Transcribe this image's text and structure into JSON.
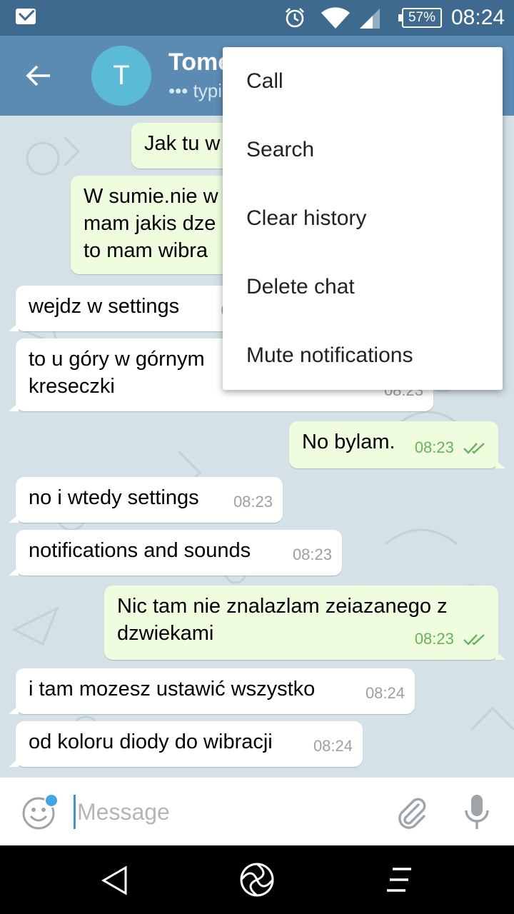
{
  "status_bar": {
    "battery": "57%",
    "time": "08:24"
  },
  "header": {
    "avatar_letter": "T",
    "contact_name": "Tomek",
    "status": "••• typing"
  },
  "menu": {
    "items": [
      {
        "label": "Call"
      },
      {
        "label": "Search"
      },
      {
        "label": "Clear history"
      },
      {
        "label": "Delete chat"
      },
      {
        "label": "Mute notifications"
      }
    ]
  },
  "messages": [
    {
      "dir": "out",
      "lines": [
        "Jak tu w"
      ],
      "time": ""
    },
    {
      "dir": "out",
      "lines": [
        "W sumie.nie w",
        "mam jakis dze",
        "to mam wibra"
      ],
      "time": ""
    },
    {
      "dir": "in",
      "lines": [
        "wejdz w settings"
      ],
      "time": "08"
    },
    {
      "dir": "in",
      "lines": [
        "to u góry w górnym",
        "kreseczki"
      ],
      "time": "08:23"
    },
    {
      "dir": "out",
      "lines": [
        "No bylam."
      ],
      "time": "08:23"
    },
    {
      "dir": "in",
      "lines": [
        "no i wtedy settings"
      ],
      "time": "08:23"
    },
    {
      "dir": "in",
      "lines": [
        "notifications and sounds"
      ],
      "time": "08:23"
    },
    {
      "dir": "out",
      "lines": [
        "Nic tam nie znalazlam zeiazanego z",
        "dzwiekami"
      ],
      "time": "08:23"
    },
    {
      "dir": "in",
      "lines": [
        "i tam mozesz ustawić wszystko"
      ],
      "time": "08:24"
    },
    {
      "dir": "in",
      "lines": [
        "od koloru diody do wibracji"
      ],
      "time": "08:24"
    }
  ],
  "input": {
    "placeholder": "Message"
  },
  "colors": {
    "status_bar": "#3f6a8f",
    "header": "#5b8bb3",
    "avatar": "#5bbad5",
    "outgoing_bubble": "#effdde",
    "incoming_bubble": "#ffffff",
    "read_ticks": "#6ab15f"
  },
  "icons": {
    "status": [
      "mail-icon",
      "alarm-icon",
      "wifi-icon",
      "signal-icon",
      "battery-icon"
    ],
    "header": [
      "back-arrow-icon"
    ],
    "input": [
      "emoji-icon",
      "attach-icon",
      "mic-icon"
    ],
    "nav": [
      "nav-back-icon",
      "nav-home-icon",
      "nav-menu-icon"
    ]
  }
}
